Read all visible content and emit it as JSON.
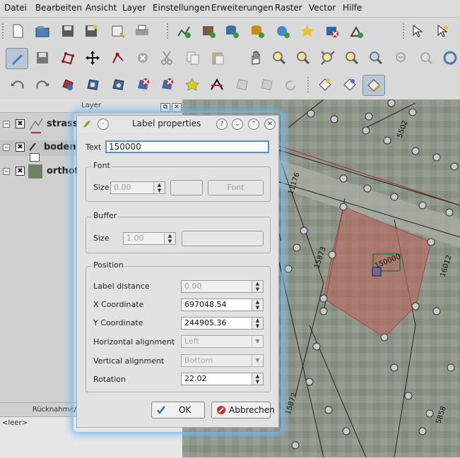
{
  "menubar": [
    "Datei",
    "Bearbeiten",
    "Ansicht",
    "Layer",
    "Einstellungen",
    "Erweiterungen",
    "Raster",
    "Vector",
    "Hilfe"
  ],
  "layer_panel": {
    "title": "Layer",
    "layers": [
      {
        "name": "strasse",
        "checked": "✖"
      },
      {
        "name": "bodenb",
        "checked": "✖"
      },
      {
        "name": "orthofo",
        "checked": "✖"
      }
    ],
    "undo_title": "Rücknahme/",
    "undo_empty": "<leer>"
  },
  "map": {
    "labels": [
      "5502",
      "11176",
      "15873",
      "16012",
      "15872",
      "5858"
    ],
    "selected_label": "150000",
    "colors": {
      "parcel_fill": "#c4786f",
      "parcel_line": "#b22222",
      "vertex": "#c9c9c9"
    }
  },
  "dialog": {
    "title": "Label properties",
    "text_label": "Text",
    "text_value": "150000",
    "font": {
      "group": "Font",
      "size_label": "Size",
      "size_value": "0.00",
      "font_button": "Font"
    },
    "buffer": {
      "group": "Buffer",
      "size_label": "Size",
      "size_value": "1.00"
    },
    "position": {
      "group": "Position",
      "label_distance_label": "Label distance",
      "label_distance_value": "0.00",
      "x_label": "X Coordinate",
      "x_value": "697048.54",
      "y_label": "Y Coordinate",
      "y_value": "244905.36",
      "halign_label": "Horizontal alignment",
      "halign_value": "Left",
      "valign_label": "Vertical alignment",
      "valign_value": "Bottom",
      "rotation_label": "Rotation",
      "rotation_value": "22.02"
    },
    "ok_label": "OK",
    "cancel_label": "Abbrechen"
  },
  "icons": [
    "new-project-icon",
    "open-project-icon",
    "save-icon",
    "save-as-icon",
    "new-print-composer-icon",
    "print-icon",
    "add-vector-icon",
    "add-raster-icon",
    "add-postgis-icon",
    "add-spatialite-icon",
    "add-wms-icon",
    "add-wfs-icon",
    "remove-layer-icon",
    "new-layer-icon",
    "identify-icon",
    "select-icon",
    "toggle-edit-icon",
    "save-edits-icon",
    "add-feature-icon",
    "move-feature-icon",
    "node-tool-icon",
    "delete-selected-icon",
    "cut-icon",
    "copy-icon",
    "paste-icon",
    "pan-icon",
    "zoom-in-icon",
    "zoom-out-icon",
    "zoom-full-icon",
    "zoom-selection-icon",
    "zoom-layer-icon",
    "zoom-last-icon",
    "zoom-next-icon",
    "refresh-icon",
    "undo-icon",
    "redo-icon",
    "simplify-icon",
    "add-ring-icon",
    "add-part-icon",
    "delete-ring-icon",
    "delete-part-icon",
    "reshape-icon",
    "split-icon",
    "merge-icon",
    "rotate-point-icon",
    "label-tool-icon",
    "move-label-icon",
    "rotate-label-icon",
    "change-label-icon"
  ]
}
